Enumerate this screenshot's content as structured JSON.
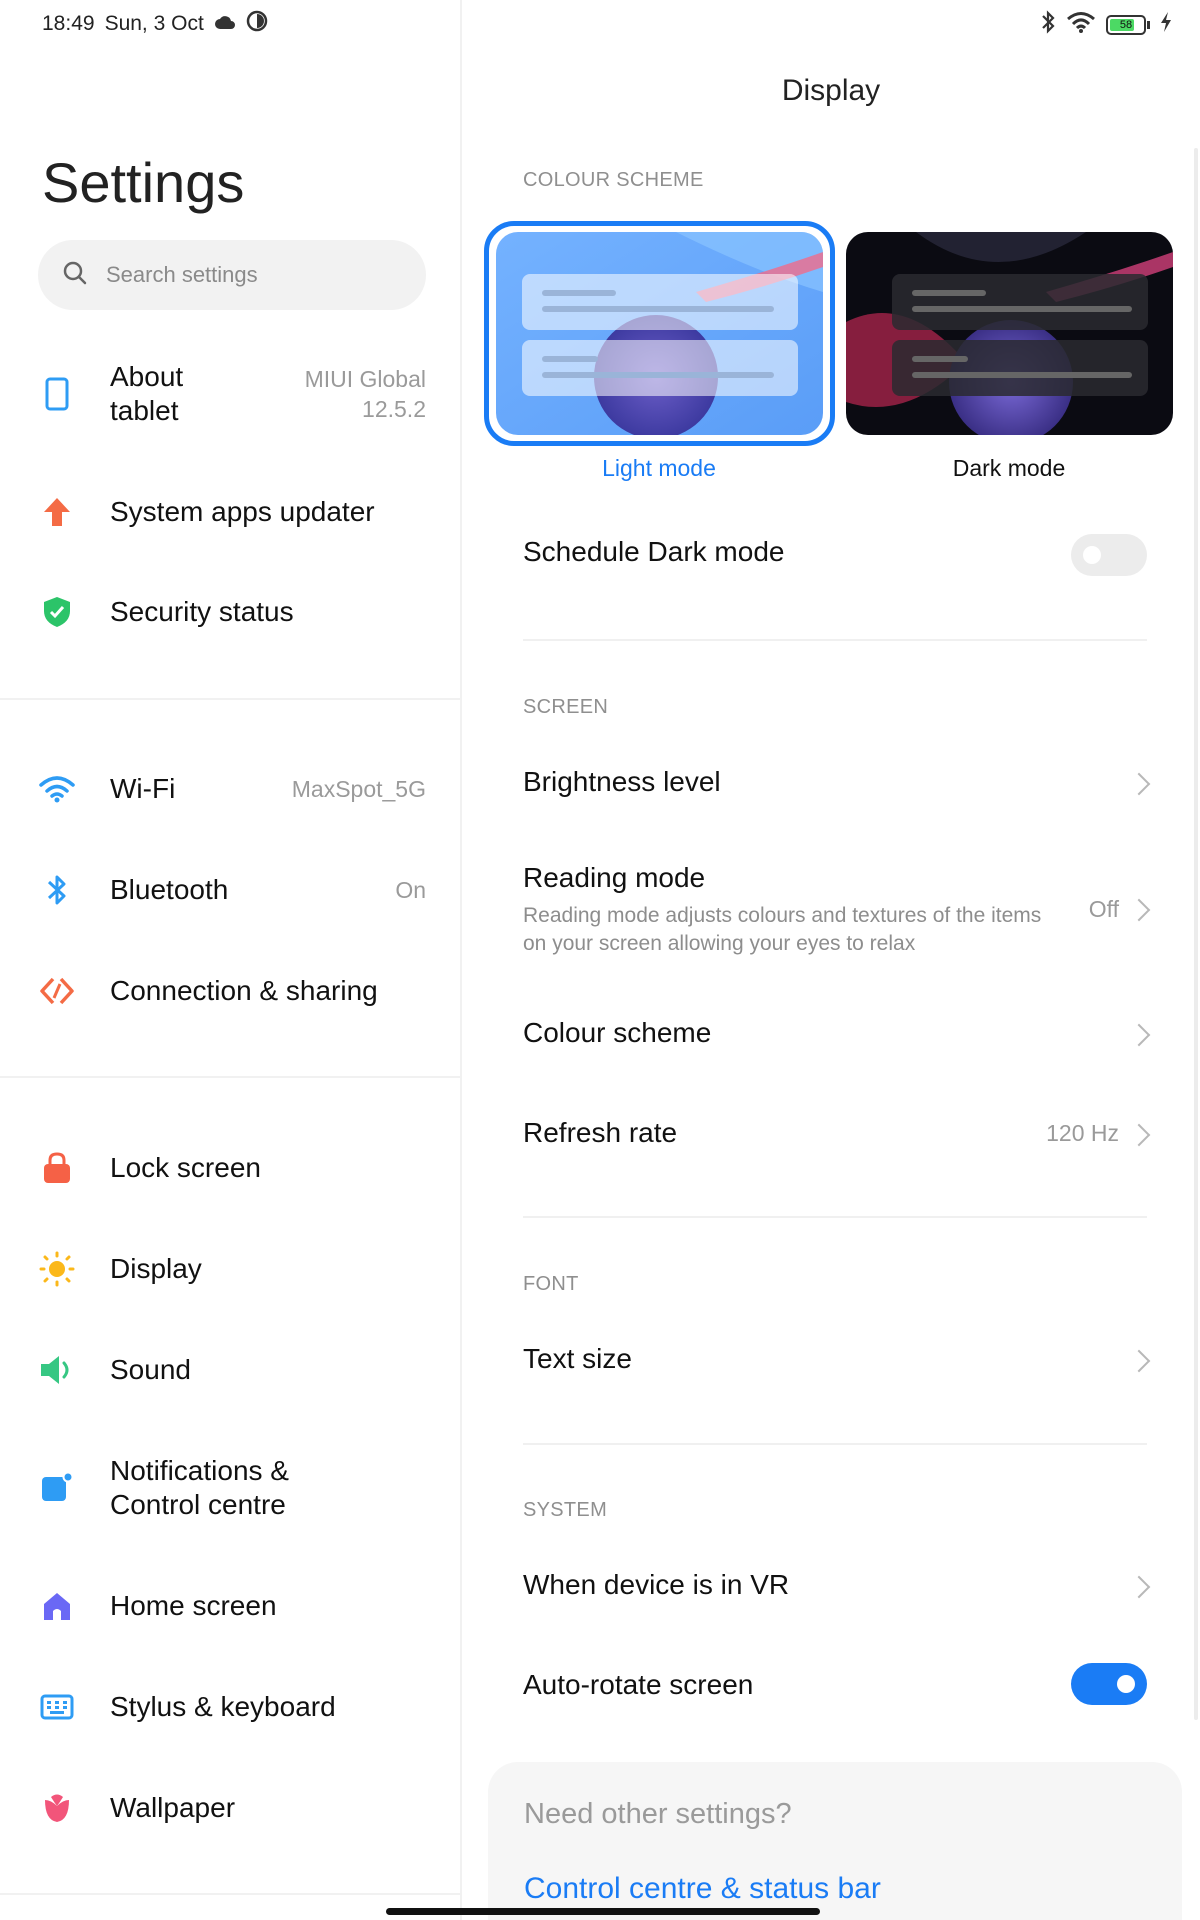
{
  "status_bar": {
    "time": "18:49",
    "date": "Sun, 3 Oct",
    "battery": "58"
  },
  "sidebar": {
    "title": "Settings",
    "search_placeholder": "Search settings",
    "items": [
      {
        "label": "About\ntablet",
        "value": "MIUI Global\n12.5.2",
        "icon": "tablet-icon"
      },
      {
        "label": "System apps updater",
        "value": "",
        "icon": "arrow-up-icon"
      },
      {
        "label": "Security status",
        "value": "",
        "icon": "shield-check-icon"
      },
      {
        "label": "Wi-Fi",
        "value": "MaxSpot_5G",
        "icon": "wifi-icon"
      },
      {
        "label": "Bluetooth",
        "value": "On",
        "icon": "bluetooth-icon"
      },
      {
        "label": "Connection & sharing",
        "value": "",
        "icon": "connection-icon"
      },
      {
        "label": "Lock screen",
        "value": "",
        "icon": "lock-icon"
      },
      {
        "label": "Display",
        "value": "",
        "icon": "sun-icon"
      },
      {
        "label": "Sound",
        "value": "",
        "icon": "speaker-icon"
      },
      {
        "label": "Notifications &\nControl centre",
        "value": "",
        "icon": "notification-icon"
      },
      {
        "label": "Home screen",
        "value": "",
        "icon": "home-icon"
      },
      {
        "label": "Stylus & keyboard",
        "value": "",
        "icon": "keyboard-icon"
      },
      {
        "label": "Wallpaper",
        "value": "",
        "icon": "flower-icon"
      }
    ]
  },
  "display": {
    "title": "Display",
    "colour_scheme_header": "COLOUR SCHEME",
    "light_mode_label": "Light mode",
    "dark_mode_label": "Dark mode",
    "schedule_dark_mode": {
      "label": "Schedule Dark mode",
      "on": false
    },
    "screen_header": "SCREEN",
    "brightness_label": "Brightness level",
    "reading_mode": {
      "label": "Reading mode",
      "summary": "Reading mode adjusts colours and textures of the items on your screen allowing your eyes to relax",
      "value": "Off"
    },
    "colour_scheme_label": "Colour scheme",
    "refresh_rate": {
      "label": "Refresh rate",
      "value": "120 Hz"
    },
    "font_header": "FONT",
    "text_size_label": "Text size",
    "system_header": "SYSTEM",
    "vr_label": "When device is in VR",
    "auto_rotate": {
      "label": "Auto-rotate screen",
      "on": true
    },
    "bottom_card": {
      "title": "Need other settings?",
      "link": "Control centre & status bar"
    }
  },
  "colors": {
    "accent": "#1a7cf5",
    "toggle_off": "#ececec"
  }
}
